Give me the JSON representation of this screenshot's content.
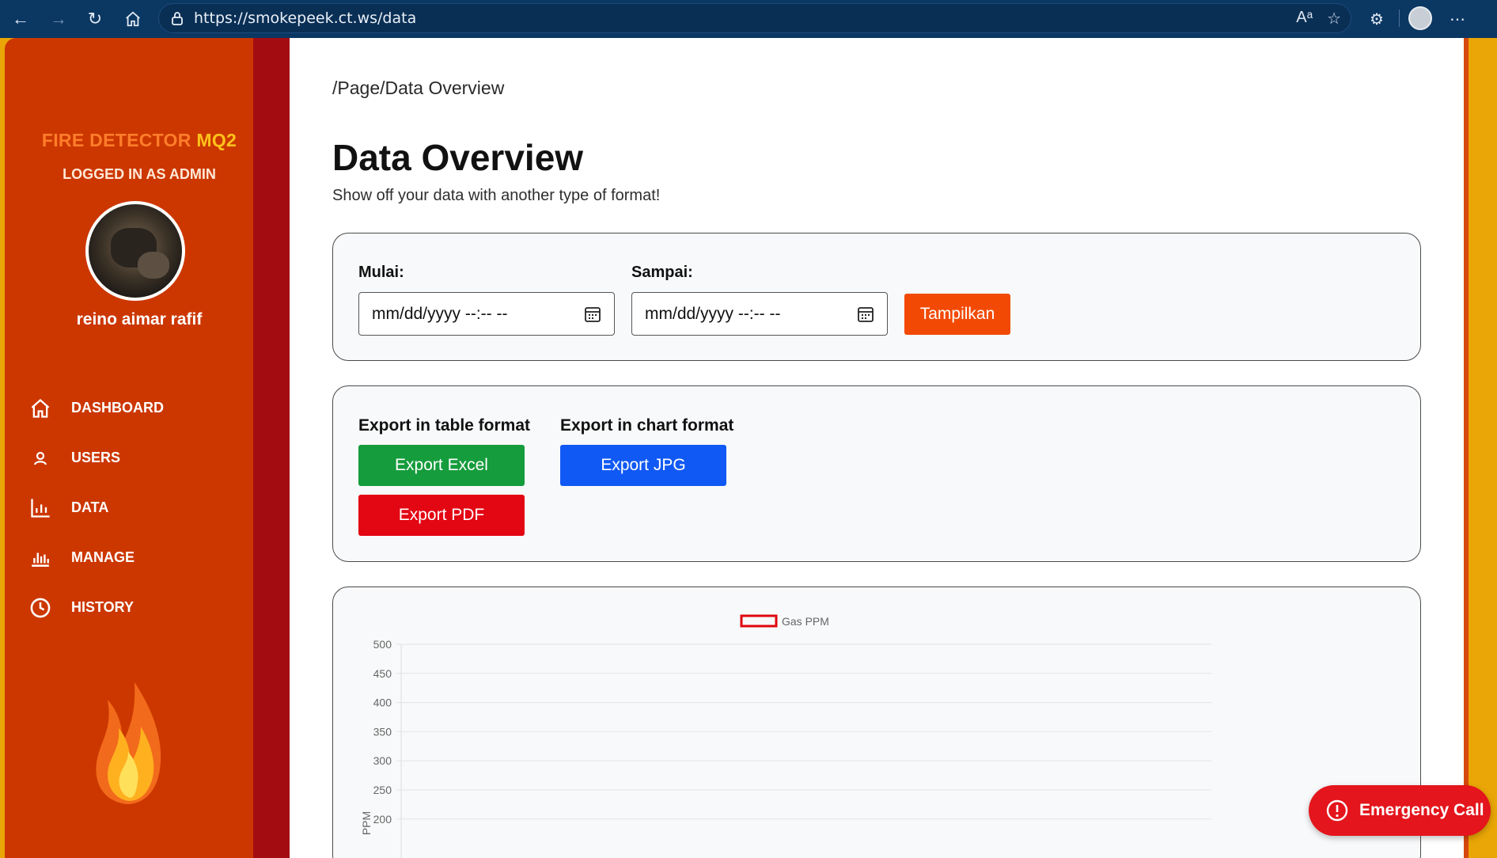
{
  "browser": {
    "url": "https://smokepeek.ct.ws/data"
  },
  "sidebar": {
    "brand_part1": "FIRE DETECTOR ",
    "brand_part2": "MQ2",
    "role_label": "LOGGED IN AS ADMIN",
    "username": "reino aimar rafif",
    "items": [
      {
        "label": "DASHBOARD",
        "icon": "home-icon"
      },
      {
        "label": "USERS",
        "icon": "user-icon"
      },
      {
        "label": "DATA",
        "icon": "bar-chart-icon"
      },
      {
        "label": "MANAGE",
        "icon": "equalizer-icon"
      },
      {
        "label": "HISTORY",
        "icon": "clock-icon"
      }
    ]
  },
  "main": {
    "breadcrumb": "/Page/Data Overview",
    "title": "Data Overview",
    "subtitle": "Show off your data with another type of format!",
    "filter": {
      "start_label": "Mulai:",
      "start_placeholder": "mm/dd/yyyy --:-- --",
      "end_label": "Sampai:",
      "end_placeholder": "mm/dd/yyyy --:-- --",
      "show_button": "Tampilkan"
    },
    "export": {
      "table_title": "Export in table format",
      "chart_title": "Export in chart format",
      "excel_button": "Export Excel",
      "pdf_button": "Export PDF",
      "jpg_button": "Export JPG"
    }
  },
  "emergency_button": "Emergency Call",
  "colors": {
    "sidebar_bg": "#cc3700",
    "brand_orange": "#ff7d2a",
    "brand_yellow": "#ffc21a",
    "show_button": "#f24a05",
    "excel_button": "#159c3c",
    "pdf_button": "#e30613",
    "jpg_button": "#1159f4",
    "emergency": "#e4151c",
    "series_border": "#e0060f"
  },
  "chart_data": {
    "type": "line",
    "series": [
      {
        "name": "Gas PPM",
        "values": []
      }
    ],
    "ylabel": "PPM",
    "yticks": [
      500,
      450,
      400,
      350,
      300,
      250,
      200
    ],
    "legend_position": "top-center",
    "grid": true
  }
}
